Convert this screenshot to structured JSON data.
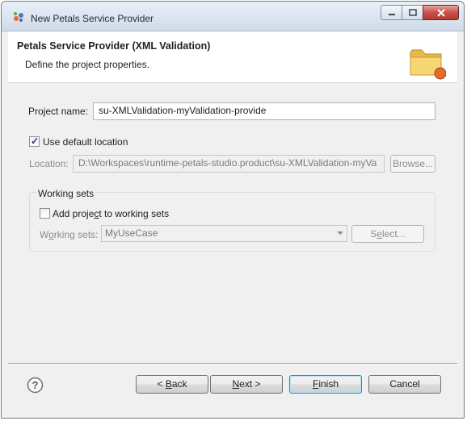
{
  "window": {
    "title": "New Petals Service Provider"
  },
  "header": {
    "title": "Petals Service Provider (XML Validation)",
    "description": "Define the project properties."
  },
  "project": {
    "name_label": "Project name:",
    "name_value": "su-XMLValidation-myValidation-provide"
  },
  "location": {
    "use_default_label": "Use default location",
    "use_default_checked": true,
    "label": "Location:",
    "value": "D:\\Workspaces\\runtime-petals-studio.product\\su-XMLValidation-myVa",
    "browse_label": "Browse..."
  },
  "working_sets": {
    "group_title": "Working sets",
    "add_label_pre": "Add proje",
    "add_label_u": "c",
    "add_label_post": "t to working sets",
    "add_checked": false,
    "sets_label_pre": "W",
    "sets_label_u": "o",
    "sets_label_post": "rking sets:",
    "selected": "MyUseCase",
    "select_pre": "S",
    "select_u": "e",
    "select_post": "lect..."
  },
  "buttons": {
    "back_pre": "< ",
    "back_u": "B",
    "back_post": "ack",
    "next_u": "N",
    "next_post": "ext >",
    "finish_u": "F",
    "finish_post": "inish",
    "cancel": "Cancel"
  },
  "icons": {
    "app": "petals-app-icon",
    "banner": "folder-icon",
    "help": "help-icon"
  }
}
